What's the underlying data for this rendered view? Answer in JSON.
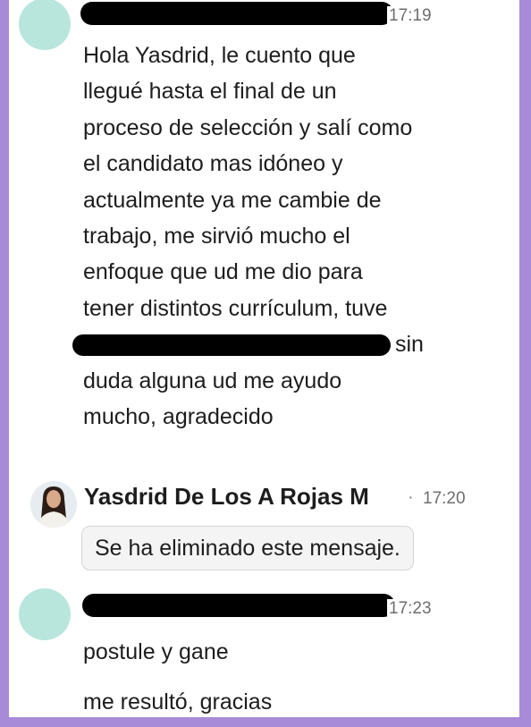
{
  "messages": [
    {
      "time": "17:19",
      "lines": [
        "Hola Yasdrid,  le cuento que",
        "llegué hasta el final de un",
        "proceso de selección y salí como",
        "el candidato mas idóneo y",
        "actualmente ya me cambie de",
        "trabajo,  me sirvió mucho el",
        "enfoque que ud me dio para",
        "tener distintos currículum, tuve",
        "sin",
        "duda alguna ud me  ayudo",
        "mucho,  agradecido"
      ]
    },
    {
      "sender": "Yasdrid De Los A Rojas M",
      "separator": "·",
      "time": "17:20",
      "deleted_text": "Se ha eliminado este mensaje."
    },
    {
      "time": "17:23",
      "lines": [
        "postule y gane",
        "me resultó, gracias"
      ]
    }
  ],
  "colors": {
    "background_border": "#a78bd9",
    "avatar_placeholder": "#b9e6dc",
    "redaction": "#000000"
  }
}
